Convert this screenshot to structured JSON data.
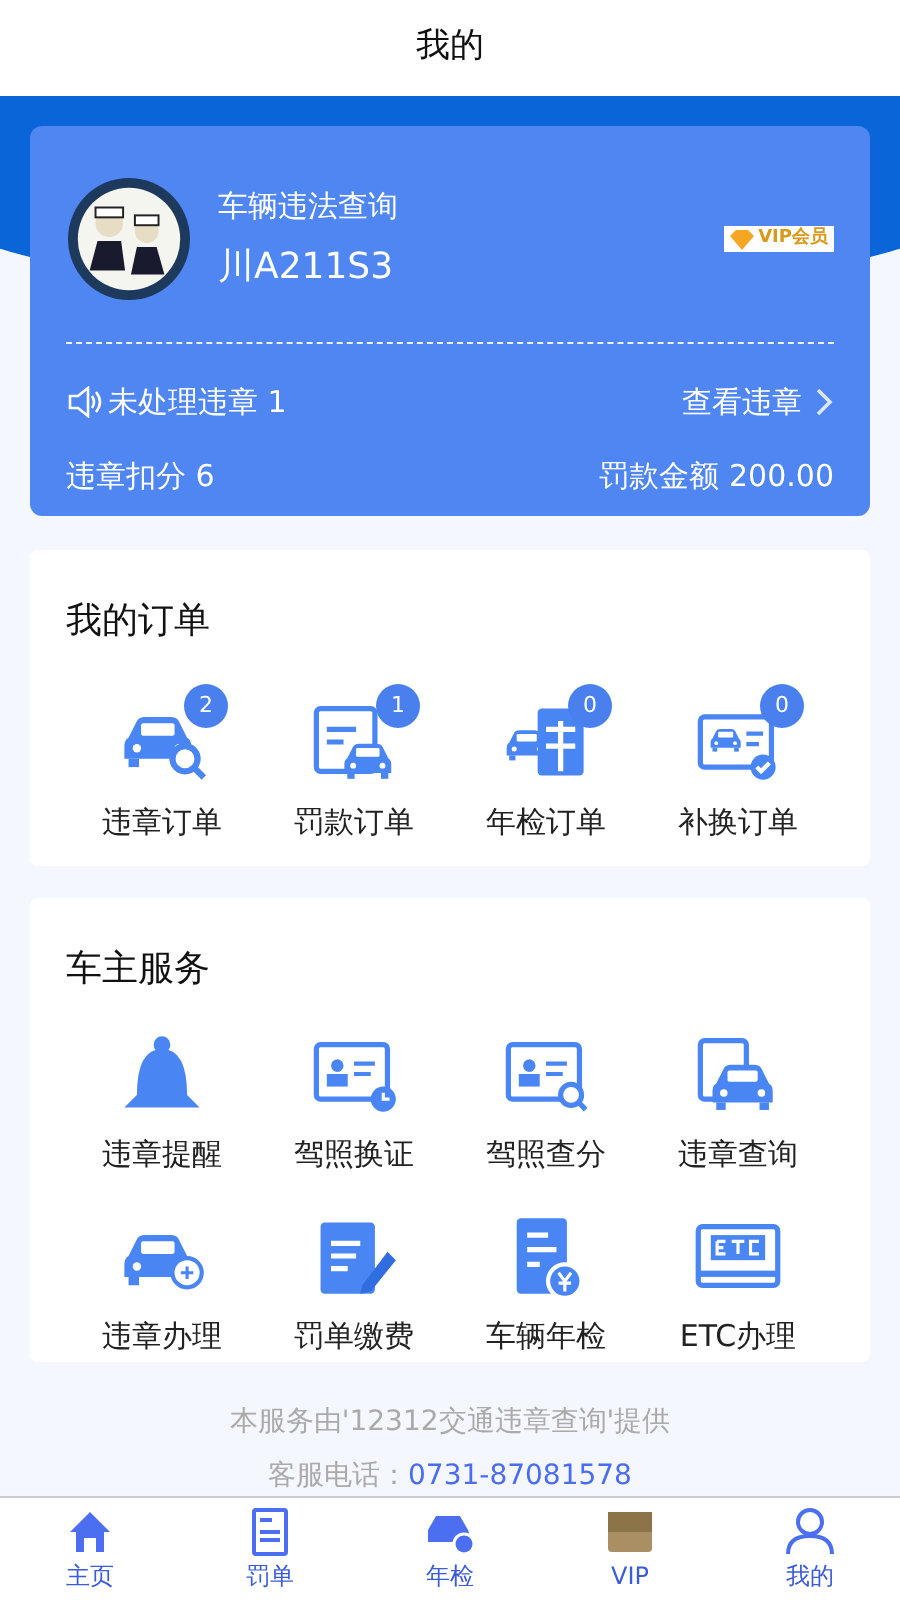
{
  "header": {
    "title": "我的"
  },
  "vehicle_card": {
    "app_name": "车辆违法查询",
    "plate": "川A211S3",
    "badge": "VIP会员",
    "unhandled": "未处理违章 1",
    "view_link": "查看违章",
    "points": "违章扣分 6",
    "fine": "罚款金额 200.00"
  },
  "orders": {
    "title": "我的订单",
    "items": [
      {
        "label": "违章订单",
        "count": "2"
      },
      {
        "label": "罚款订单",
        "count": "1"
      },
      {
        "label": "年检订单",
        "count": "0"
      },
      {
        "label": "补换订单",
        "count": "0"
      }
    ]
  },
  "services": {
    "title": "车主服务",
    "items": [
      {
        "label": "违章提醒"
      },
      {
        "label": "驾照换证"
      },
      {
        "label": "驾照查分"
      },
      {
        "label": "违章查询"
      },
      {
        "label": "违章办理"
      },
      {
        "label": "罚单缴费"
      },
      {
        "label": "车辆年检"
      },
      {
        "label": "ETC办理"
      }
    ]
  },
  "footer": {
    "note": "本服务由'12312交通违章查询'提供",
    "phone_label": "客服电话：",
    "phone": "0731-87081578"
  },
  "tab_bar": [
    {
      "label": "主页"
    },
    {
      "label": "罚单"
    },
    {
      "label": "年检"
    },
    {
      "label": "VIP"
    },
    {
      "label": "我的"
    }
  ]
}
